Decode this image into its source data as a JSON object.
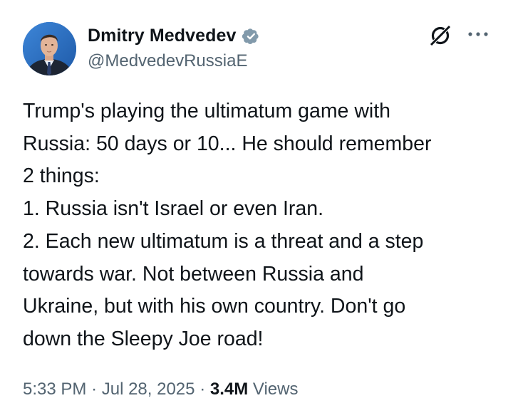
{
  "author": {
    "display_name": "Dmitry Medvedev",
    "handle": "@MedvedevRussiaE",
    "verified_icon": "verified-badge-icon",
    "avatar": "profile-photo"
  },
  "header_actions": {
    "grok_icon": "grok-slash-icon",
    "more_icon": "more-options-icon"
  },
  "tweet": {
    "lines": [
      "Trump's playing the ultimatum game with",
      "Russia: 50 days or 10... He should remember",
      "2 things:",
      "1. Russia isn't Israel or even Iran.",
      "2. Each new ultimatum is a threat and a step",
      "towards war. Not between Russia and",
      "Ukraine, but with his own country. Don't go",
      "down the Sleepy Joe road!"
    ]
  },
  "meta": {
    "time": "5:33 PM",
    "separator": "·",
    "date": "Jul 28, 2025",
    "views_count": "3.4M",
    "views_label": "Views"
  },
  "colors": {
    "text_primary": "#0f1419",
    "text_secondary": "#536471",
    "verified_badge": "#829aab",
    "background": "#ffffff"
  }
}
